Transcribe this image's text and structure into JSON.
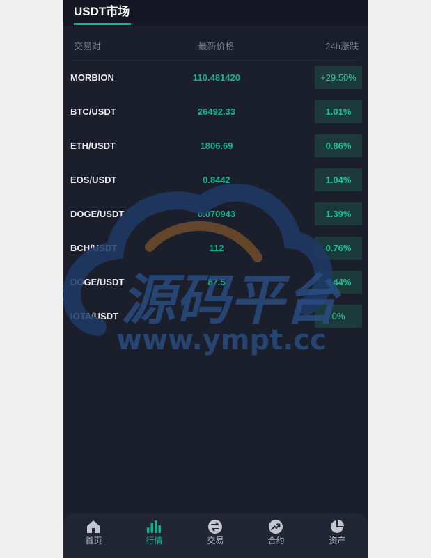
{
  "header": {
    "market_tab": "USDT市场"
  },
  "columns": {
    "pair": "交易对",
    "price": "最新价格",
    "change": "24h涨跌"
  },
  "rows": [
    {
      "pair": "MORBION",
      "price": "110.481420",
      "change": "+29.50%"
    },
    {
      "pair": "BTC/USDT",
      "price": "26492.33",
      "change": "1.01%"
    },
    {
      "pair": "ETH/USDT",
      "price": "1806.69",
      "change": "0.86%"
    },
    {
      "pair": "EOS/USDT",
      "price": "0.8442",
      "change": "1.04%"
    },
    {
      "pair": "DOGE/USDT",
      "price": "0.070943",
      "change": "1.39%"
    },
    {
      "pair": "BCH/USDT",
      "price": "112",
      "change": "0.76%"
    },
    {
      "pair": "DOGE/USDT",
      "price": "87.5",
      "change": "3.44%"
    },
    {
      "pair": "IOTA/USDT",
      "price": "",
      "change": "0%"
    }
  ],
  "watermark": {
    "brand": "源码平台",
    "url": "www.ympt.cc"
  },
  "nav": {
    "items": [
      {
        "label": "首页",
        "icon": "home-icon"
      },
      {
        "label": "行情",
        "icon": "chart-bar-icon"
      },
      {
        "label": "交易",
        "icon": "exchange-icon"
      },
      {
        "label": "合约",
        "icon": "trend-up-icon"
      },
      {
        "label": "资产",
        "icon": "pie-chart-icon"
      }
    ]
  },
  "colors": {
    "background": "#1b1e2b",
    "accent": "#13b58a",
    "change_bg": "#1d3a3a",
    "nav_bg": "#222634"
  }
}
